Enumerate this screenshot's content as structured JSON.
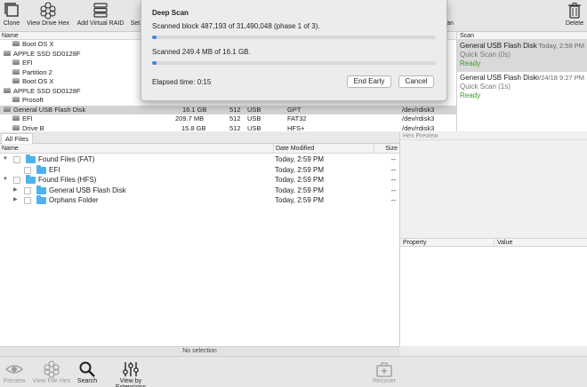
{
  "toolbar": {
    "items": [
      {
        "label": "Clone",
        "icon": "clone-icon"
      },
      {
        "label": "View Drive Hex",
        "icon": "hex-icon"
      },
      {
        "label": "Add Virtual RAID",
        "icon": "raid-icon"
      },
      {
        "label": "Set",
        "icon": "set-icon"
      },
      {
        "label": "an",
        "icon": ""
      },
      {
        "label": "Delete",
        "icon": "trash-icon"
      }
    ]
  },
  "disks": {
    "header": "Name",
    "rows": [
      {
        "name": "Boot OS X",
        "size": "",
        "block": "",
        "iface": "",
        "scheme": "",
        "dev": ""
      },
      {
        "name": "APPLE SSD SD0128F",
        "size": "",
        "block": "",
        "iface": "",
        "scheme": "",
        "dev": ""
      },
      {
        "name": "EFI",
        "size": "",
        "block": "",
        "iface": "",
        "scheme": "",
        "dev": ""
      },
      {
        "name": "Partition 2",
        "size": "",
        "block": "",
        "iface": "",
        "scheme": "",
        "dev": ""
      },
      {
        "name": "Boot OS X",
        "size": "",
        "block": "",
        "iface": "",
        "scheme": "",
        "dev": ""
      },
      {
        "name": "APPLE SSD SD0128F",
        "size": "",
        "block": "",
        "iface": "",
        "scheme": "",
        "dev": ""
      },
      {
        "name": "Prosoft",
        "size": "",
        "block": "",
        "iface": "",
        "scheme": "",
        "dev": ""
      },
      {
        "name": "General USB Flash Disk",
        "size": "16.1 GB",
        "block": "512",
        "iface": "USB",
        "scheme": "GPT",
        "dev": "/dev/rdisk3"
      },
      {
        "name": "EFI",
        "size": "209.7 MB",
        "block": "512",
        "iface": "USB",
        "scheme": "FAT32",
        "dev": "/dev/rdisk3"
      },
      {
        "name": "Drive B",
        "size": "15.8 GB",
        "block": "512",
        "iface": "USB",
        "scheme": "HFS+",
        "dev": "/dev/rdisk3"
      }
    ]
  },
  "scan_panel": {
    "header": "Scan",
    "items": [
      {
        "title": "General USB Flash Disk",
        "date": "Today, 2:59 PM",
        "sub": "Quick Scan (0s)",
        "status": "Ready"
      },
      {
        "title": "General USB Flash Disk",
        "date": "9/24/18 9:27 PM",
        "sub": "Quick Scan (1s)",
        "status": "Ready"
      }
    ]
  },
  "tabs": {
    "all_files": "All Files"
  },
  "hex_preview": {
    "label": "Hex Preview"
  },
  "files": {
    "columns": {
      "name": "Name",
      "date": "Date Modified",
      "size": "Size"
    },
    "rows": [
      {
        "name": "Found Files (FAT)",
        "date": "Today, 2:59 PM",
        "size": "--"
      },
      {
        "name": "EFI",
        "date": "Today, 2:59 PM",
        "size": "--"
      },
      {
        "name": "Found Files (HFS)",
        "date": "Today, 2:59 PM",
        "size": "--"
      },
      {
        "name": "General USB Flash Disk",
        "date": "Today, 2:59 PM",
        "size": "--"
      },
      {
        "name": "Orphans Folder",
        "date": "Today, 2:59 PM",
        "size": "--"
      }
    ]
  },
  "properties": {
    "property": "Property",
    "value": "Value"
  },
  "status": {
    "text": "No selection"
  },
  "bottom": {
    "preview": "Preview",
    "view_file_hex": "View File Hex",
    "search": "Search",
    "view_by_extensions": "View by Extensions",
    "recover": "Recover"
  },
  "sheet": {
    "title": "Deep Scan",
    "line1": "Scanned block 487,193 of 31,490,048 (phase 1 of 3).",
    "progress1": 0.0155,
    "line2": "Scanned 249.4 MB of 16.1 GB.",
    "progress2": 0.0155,
    "elapsed": "Elapsed time: 0:15",
    "end_early": "End Early",
    "cancel": "Cancel"
  },
  "colors": {
    "ready": "#3c9a2a",
    "folder": "#4fb2ef",
    "progress": "#3b82f6"
  }
}
